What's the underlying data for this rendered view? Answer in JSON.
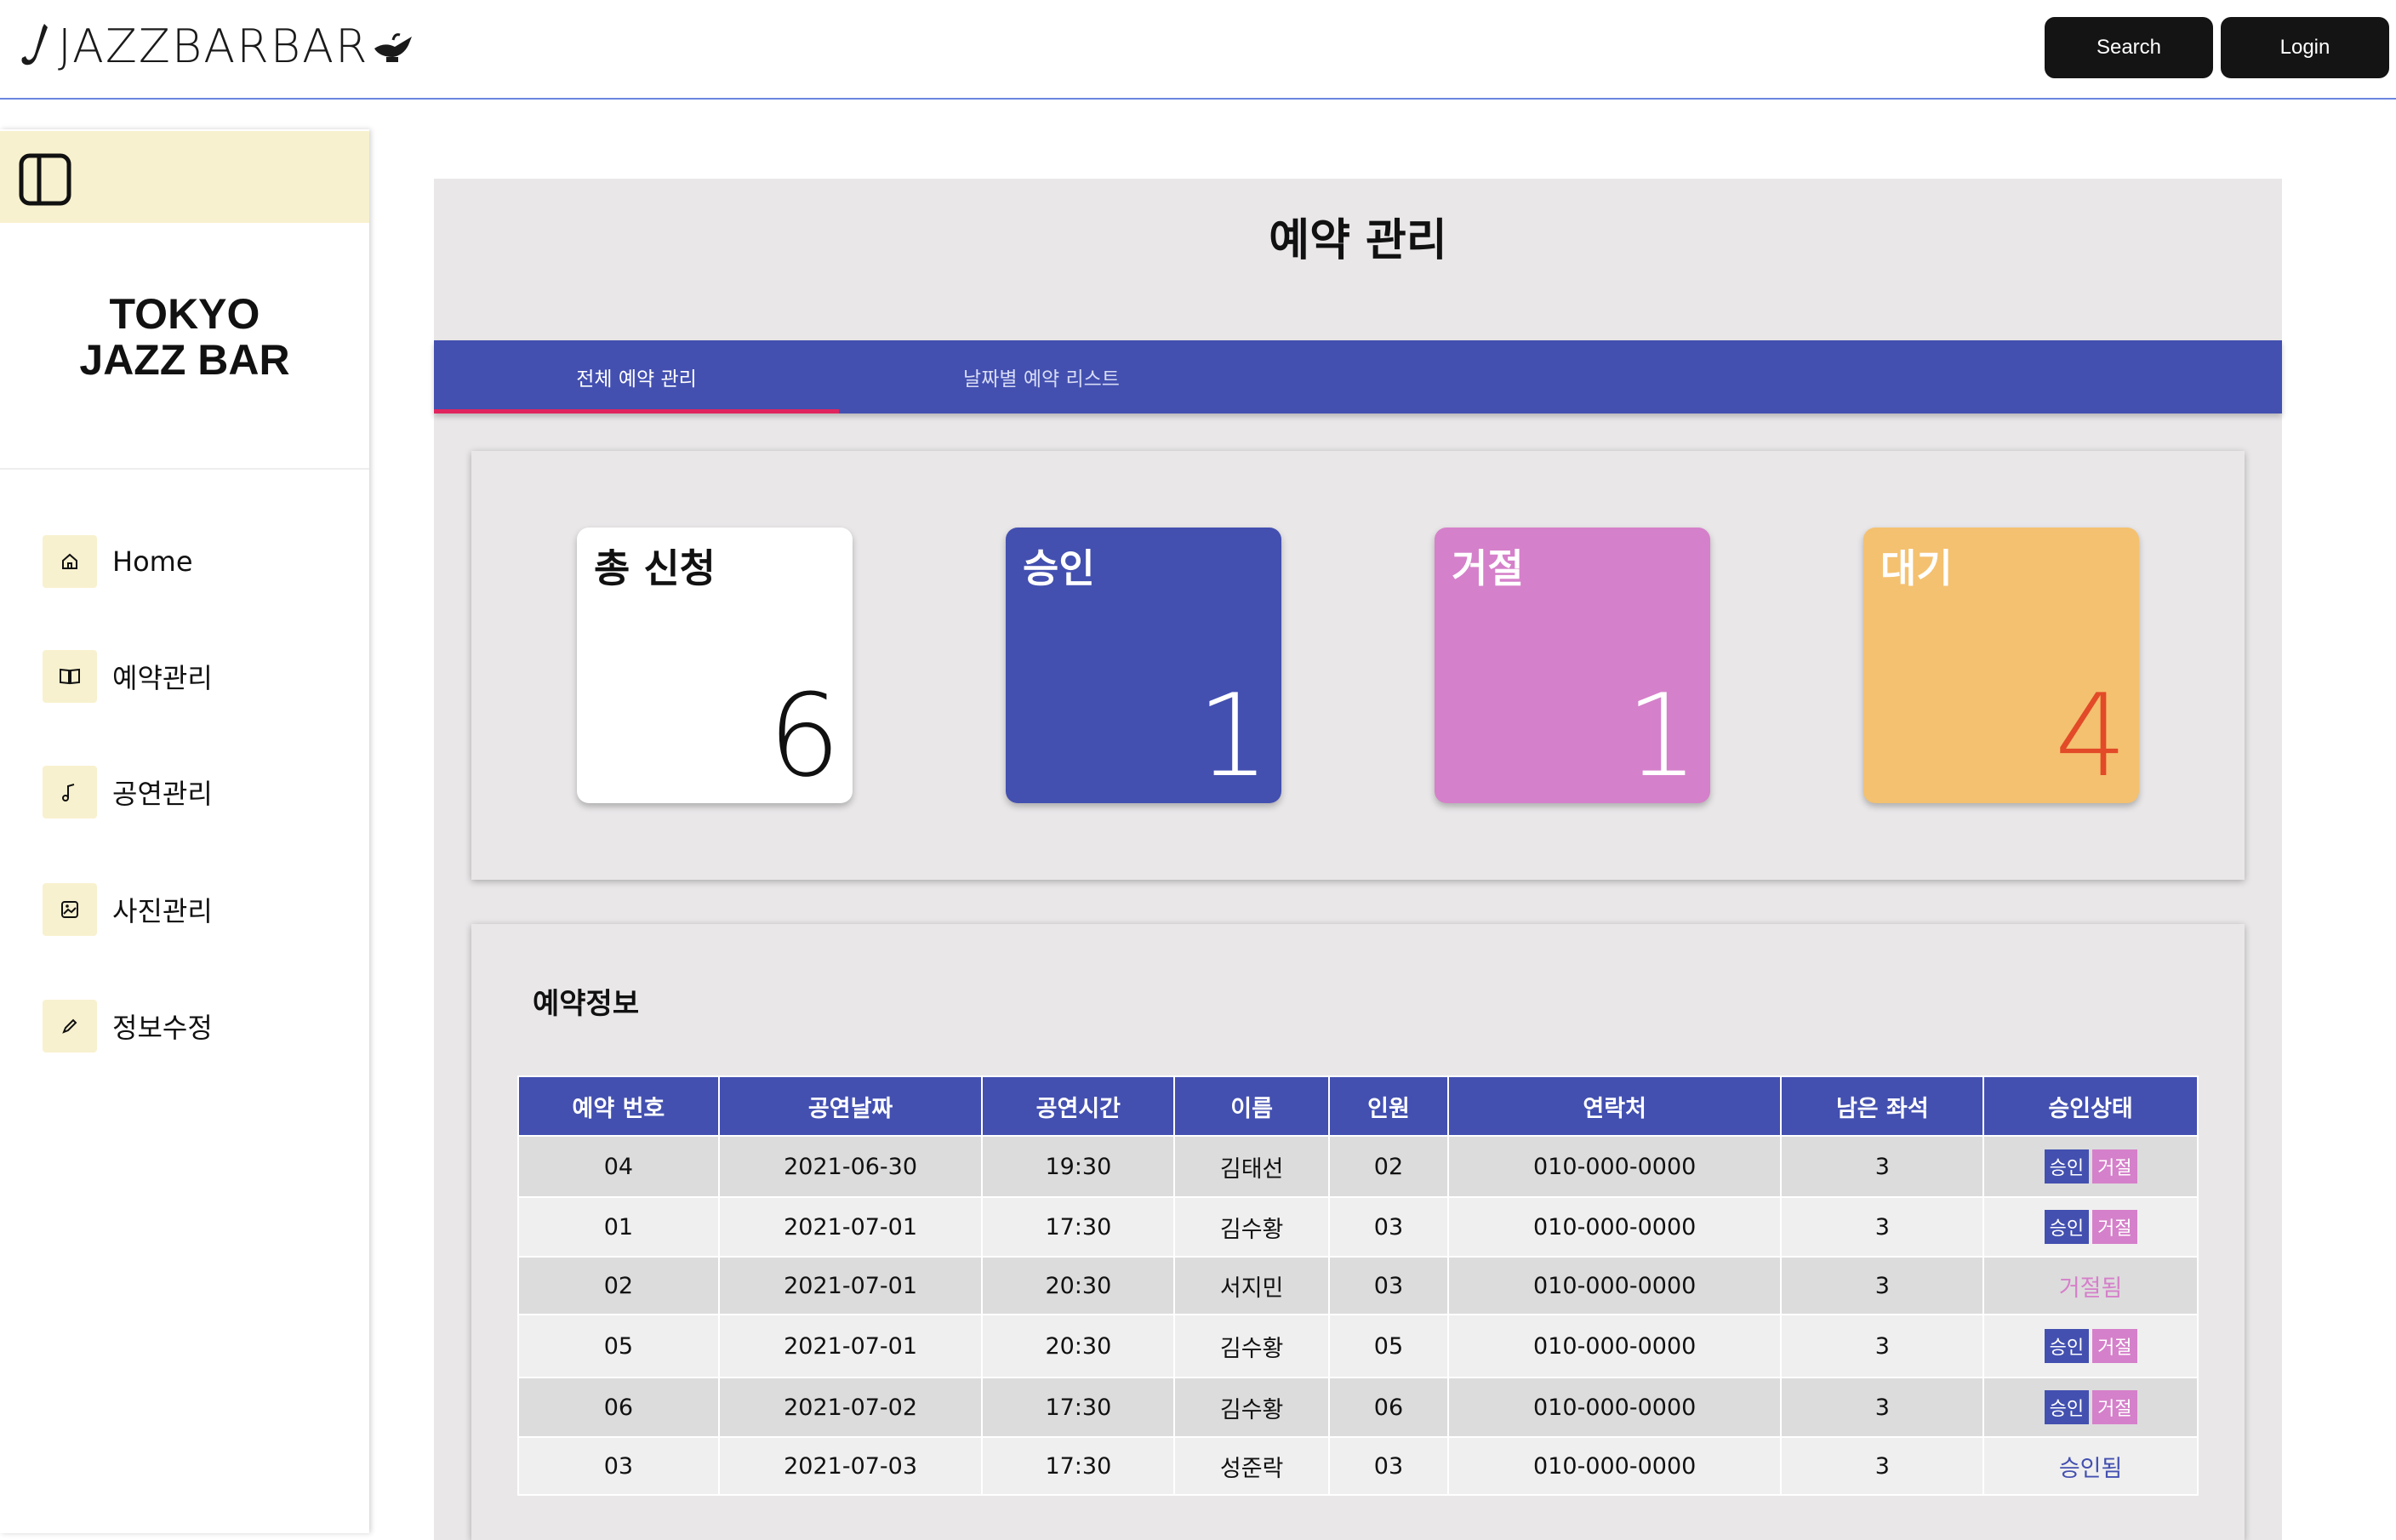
{
  "header": {
    "logo_text": "JAZZBARBAR",
    "search_label": "Search",
    "login_label": "Login"
  },
  "sidebar": {
    "brand_line1": "TOKYO",
    "brand_line2": "JAZZ BAR",
    "items": [
      {
        "label": "Home",
        "icon": "home-icon"
      },
      {
        "label": "예약관리",
        "icon": "book-icon"
      },
      {
        "label": "공연관리",
        "icon": "music-note-icon"
      },
      {
        "label": "사진관리",
        "icon": "image-icon"
      },
      {
        "label": "정보수정",
        "icon": "pencil-icon"
      }
    ]
  },
  "main": {
    "title": "예약 관리",
    "tabs": [
      {
        "label": "전체 예약 관리",
        "active": true
      },
      {
        "label": "날짜별 예약 리스트",
        "active": false
      }
    ],
    "stats": [
      {
        "title": "총 신청",
        "value": "6"
      },
      {
        "title": "승인",
        "value": "1"
      },
      {
        "title": "거절",
        "value": "1"
      },
      {
        "title": "대기",
        "value": "4"
      }
    ],
    "info_title": "예약정보",
    "table": {
      "headers": [
        "예약 번호",
        "공연날짜",
        "공연시간",
        "이름",
        "인원",
        "연락처",
        "남은 좌석",
        "승인상태"
      ],
      "rows": [
        {
          "no": "04",
          "date": "2021-06-30",
          "time": "19:30",
          "name": "김태선",
          "count": "02",
          "phone": "010-000-0000",
          "seats": "3",
          "status": "pending"
        },
        {
          "no": "01",
          "date": "2021-07-01",
          "time": "17:30",
          "name": "김수황",
          "count": "03",
          "phone": "010-000-0000",
          "seats": "3",
          "status": "pending"
        },
        {
          "no": "02",
          "date": "2021-07-01",
          "time": "20:30",
          "name": "서지민",
          "count": "03",
          "phone": "010-000-0000",
          "seats": "3",
          "status": "rejected"
        },
        {
          "no": "05",
          "date": "2021-07-01",
          "time": "20:30",
          "name": "김수황",
          "count": "05",
          "phone": "010-000-0000",
          "seats": "3",
          "status": "pending"
        },
        {
          "no": "06",
          "date": "2021-07-02",
          "time": "17:30",
          "name": "김수황",
          "count": "06",
          "phone": "010-000-0000",
          "seats": "3",
          "status": "pending"
        },
        {
          "no": "03",
          "date": "2021-07-03",
          "time": "17:30",
          "name": "성준락",
          "count": "03",
          "phone": "010-000-0000",
          "seats": "3",
          "status": "approved"
        }
      ],
      "approve_label": "승인",
      "reject_label": "거절",
      "rejected_text": "거절됨",
      "approved_text": "승인됨"
    }
  },
  "colors": {
    "primary": "#4350b0",
    "reject": "#d580ca",
    "wait": "#f4c170",
    "wait_number": "#e24a28",
    "sidebar_accent": "#f8f1cf",
    "tab_indicator": "#e0245e"
  }
}
